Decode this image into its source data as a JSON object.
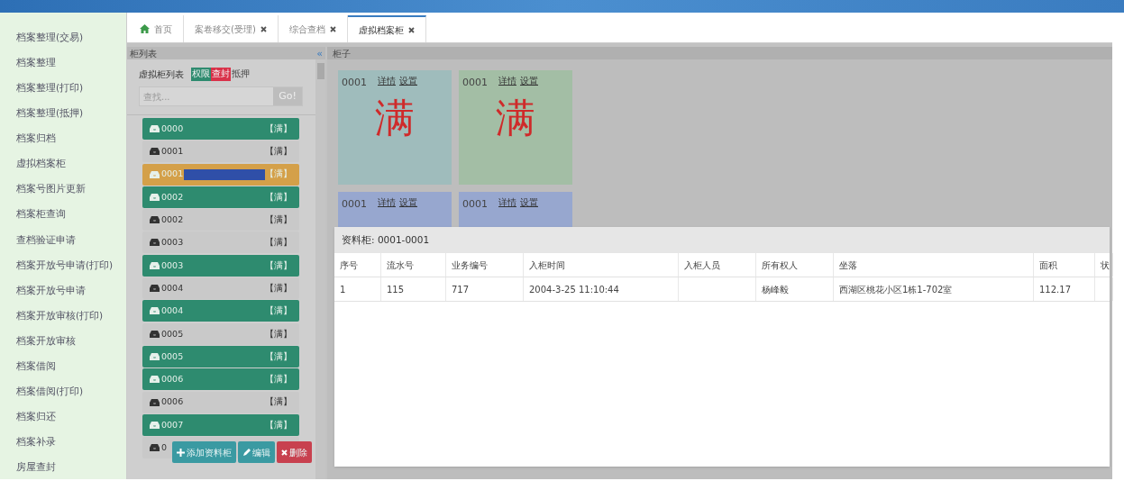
{
  "sidebar": {
    "items": [
      {
        "label": "档案整理(交易)"
      },
      {
        "label": "档案整理"
      },
      {
        "label": "档案整理(打印)"
      },
      {
        "label": "档案整理(抵押)"
      },
      {
        "label": "档案归档"
      },
      {
        "label": "虚拟档案柜"
      },
      {
        "label": "档案号图片更新"
      },
      {
        "label": "档案柜查询"
      },
      {
        "label": "查档验证申请"
      },
      {
        "label": "档案开放号申请(打印)"
      },
      {
        "label": "档案开放号申请"
      },
      {
        "label": "档案开放审核(打印)"
      },
      {
        "label": "档案开放审核"
      },
      {
        "label": "档案借阅"
      },
      {
        "label": "档案借阅(打印)"
      },
      {
        "label": "档案归还"
      },
      {
        "label": "档案补录"
      },
      {
        "label": "房屋查封"
      }
    ]
  },
  "tabs": [
    {
      "label": "首页",
      "kind": "home",
      "closable": false,
      "selected": false
    },
    {
      "label": "案卷移交(受理)",
      "kind": "page",
      "closable": true,
      "selected": false
    },
    {
      "label": "综合查档",
      "kind": "page",
      "closable": true,
      "selected": false
    },
    {
      "label": "虚拟档案柜",
      "kind": "page",
      "closable": true,
      "selected": true
    }
  ],
  "left_panel": {
    "title": "柜列表",
    "collapse": "«",
    "list_title": "虚拟柜列表",
    "legend": [
      {
        "label": "权限",
        "color": "#2e8b6f"
      },
      {
        "label": "查封",
        "color": "#d9324a"
      },
      {
        "label": "抵押"
      }
    ],
    "search": {
      "placeholder": "查找...",
      "button": "Go!"
    },
    "cabinets": [
      {
        "label": "0000",
        "status": "【满】",
        "color": "#2e8b6f"
      },
      {
        "label": "0001",
        "status": "【满】",
        "color": "#c9c9c9"
      },
      {
        "label": "0001",
        "status": "【满】",
        "color": "#d4a049",
        "redacted": true
      },
      {
        "label": "0002",
        "status": "【满】",
        "color": "#2e8b6f"
      },
      {
        "label": "0002",
        "status": "【满】",
        "color": "#c9c9c9"
      },
      {
        "label": "0003",
        "status": "【满】",
        "color": "#c9c9c9"
      },
      {
        "label": "0003",
        "status": "【满】",
        "color": "#2e8b6f"
      },
      {
        "label": "0004",
        "status": "【满】",
        "color": "#c9c9c9"
      },
      {
        "label": "0004",
        "status": "【满】",
        "color": "#2e8b6f"
      },
      {
        "label": "0005",
        "status": "【满】",
        "color": "#c9c9c9"
      },
      {
        "label": "0005",
        "status": "【满】",
        "color": "#2e8b6f"
      },
      {
        "label": "0006",
        "status": "【满】",
        "color": "#2e8b6f"
      },
      {
        "label": "0006",
        "status": "【满】",
        "color": "#c9c9c9"
      },
      {
        "label": "0007",
        "status": "【满】",
        "color": "#2e8b6f"
      },
      {
        "label": "0",
        "color": "#c9c9c9"
      }
    ],
    "buttons": [
      {
        "label": "添加资料柜",
        "kind": "add"
      },
      {
        "label": "编辑",
        "kind": "edit"
      },
      {
        "label": "删除",
        "kind": "delete"
      }
    ]
  },
  "right_panel": {
    "title": "柜子",
    "boxes": [
      {
        "number": "0001",
        "links": [
          "详情",
          "设置"
        ],
        "mark": "满",
        "color": "#9fbcbc"
      },
      {
        "number": "0001",
        "links": [
          "详情",
          "设置"
        ],
        "mark": "满",
        "color": "#a3bea5"
      },
      {
        "number": "0001",
        "links": [
          "详情",
          "设置"
        ],
        "color": "#97a7cf"
      },
      {
        "number": "0001",
        "links": [
          "详情",
          "设置"
        ],
        "color": "#97a7cf"
      }
    ]
  },
  "dialog": {
    "title": "资料柜: 0001-0001",
    "table": {
      "columns": [
        "序号",
        "流水号",
        "业务编号",
        "入柜时间",
        "入柜人员",
        "所有权人",
        "坐落",
        "面积",
        "状"
      ],
      "rows": [
        [
          "1",
          "115",
          "717",
          "2004-3-25 11:10:44",
          null,
          "杨峰毅",
          "西湖区桃花小区1栋1-702室",
          "112.17",
          null
        ]
      ]
    }
  }
}
